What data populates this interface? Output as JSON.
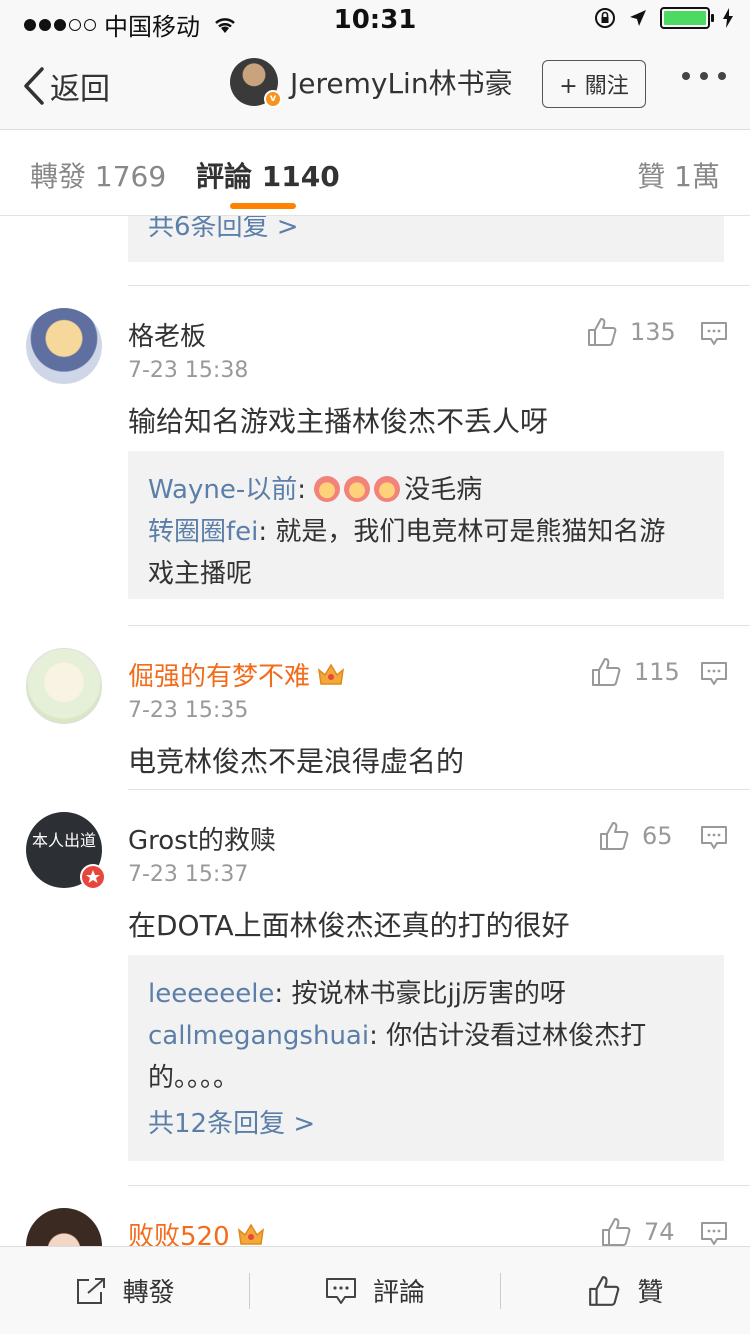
{
  "status_bar": {
    "carrier": "中国移动",
    "time": "10:31"
  },
  "nav": {
    "back_label": "返回",
    "title": "JeremyLin林书豪",
    "follow_label": "+ 關注"
  },
  "tabs": [
    {
      "label": "轉發 1769"
    },
    {
      "label": "評論 1140"
    },
    {
      "label": "贊 1萬"
    }
  ],
  "top_partial": {
    "more_replies": "共6条回复 >"
  },
  "comments": [
    {
      "name": "格老板",
      "time": "7-23 15:38",
      "text": "输给知名游戏主播林俊杰不丢人呀",
      "likes": "135",
      "replies": [
        {
          "name": "Wayne-以前",
          "sep": ": ",
          "text": "没毛病"
        },
        {
          "name": "转圈圈fei",
          "sep": ": ",
          "text": "就是，我们电竞林可是熊猫知名游",
          "text2": "戏主播呢"
        }
      ]
    },
    {
      "name": "倔强的有梦不难",
      "time": "7-23 15:35",
      "text": "电竞林俊杰不是浪得虚名的",
      "likes": "115"
    },
    {
      "name": "Grost的救赎",
      "time": "7-23 15:37",
      "text": "在DOTA上面林俊杰还真的打的很好",
      "likes": "65",
      "avatar_text": "本人出道",
      "replies": [
        {
          "name": "leeeeeele",
          "sep": ": ",
          "text": "按说林书豪比jj厉害的呀"
        },
        {
          "name": "callmegangshuai",
          "sep": ": ",
          "text": "你估计没看过林俊杰打",
          "text2": "的。。。。"
        }
      ],
      "more_replies": "共12条回复 >"
    },
    {
      "name": "败败520",
      "likes": "74"
    }
  ],
  "bottom_bar": {
    "repost": "轉發",
    "comment": "評論",
    "like": "贊"
  },
  "colors": {
    "accent_orange": "#ff8200",
    "vip_name": "#f26c1b",
    "reply_name": "#5b7fa8"
  }
}
